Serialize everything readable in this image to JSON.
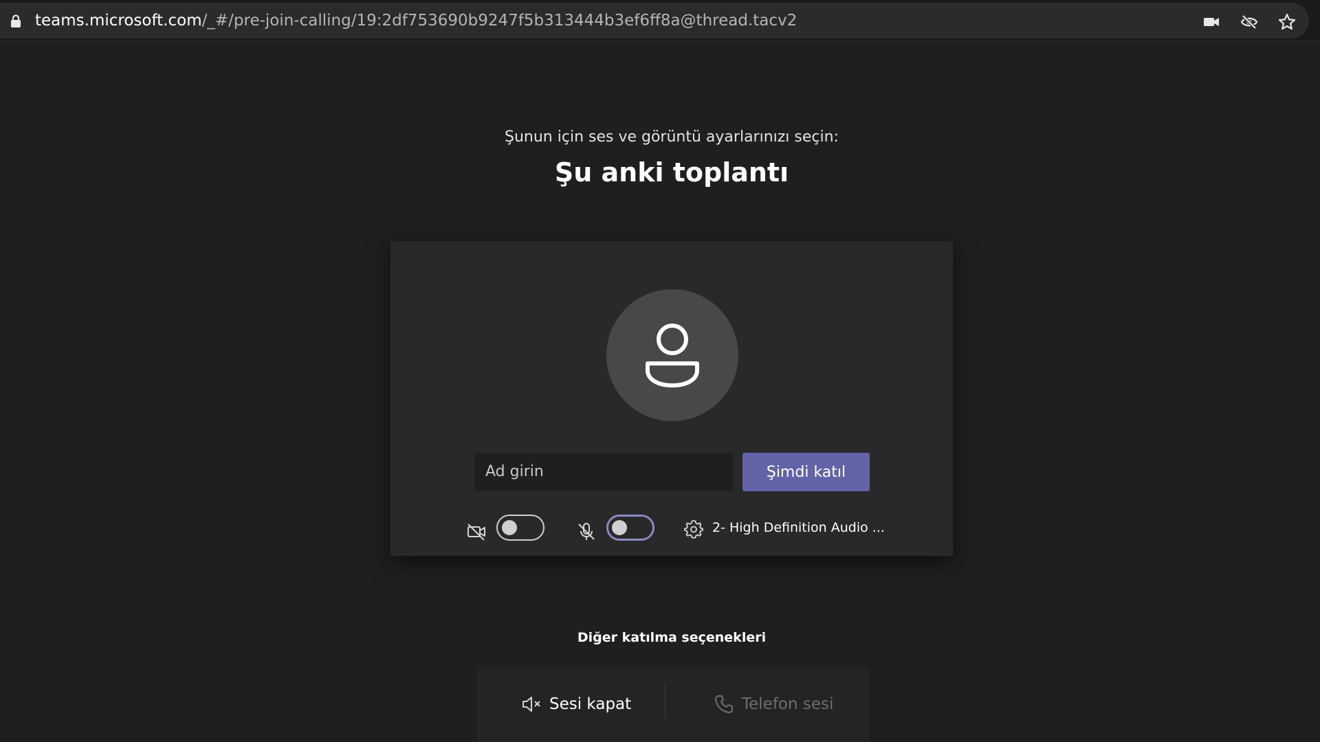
{
  "browser": {
    "url_host": "teams.microsoft.com",
    "url_path": "/_#/pre-join-calling/19:2df753690b9247f5b313444b3ef6ff8a@thread.tacv2",
    "icons": [
      "lock-icon",
      "camera-icon",
      "eye-slash-icon",
      "star-icon"
    ]
  },
  "prejoin": {
    "prompt": "Şunun için ses ve görüntü ayarlarınızı seçin:",
    "meeting_title": "Şu anki toplantı",
    "name_placeholder": "Ad girin",
    "join_label": "Şimdi katıl",
    "camera_toggle_on": false,
    "mic_toggle_on": false,
    "audio_device": "2- High Definition Audio ..."
  },
  "other_options": {
    "title": "Diğer katılma seçenekleri",
    "mute_label": "Sesi kapat",
    "phone_label": "Telefon sesi"
  },
  "colors": {
    "accent": "#6264a7",
    "background": "#1f1f1f",
    "card": "#292929",
    "disabled_text": "#6e6e6e"
  }
}
